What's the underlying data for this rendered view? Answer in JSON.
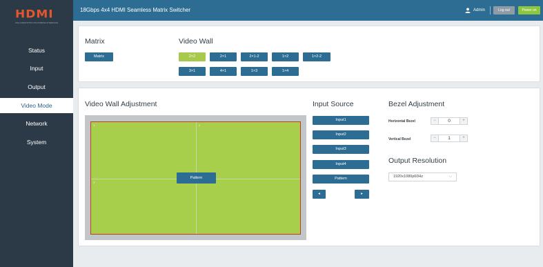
{
  "app": {
    "logo_text": "HDMI",
    "logo_tagline": "HIGH-DEFINITION MULTIMEDIA INTERFACE",
    "title": "18Gbps 4x4 HDMI Seamless Matrix Switcher"
  },
  "header": {
    "user": "Admin",
    "logout_label": "Log out",
    "power_label": "Power on"
  },
  "sidebar": {
    "items": [
      {
        "label": "Status"
      },
      {
        "label": "Input"
      },
      {
        "label": "Output"
      },
      {
        "label": "Video Mode"
      },
      {
        "label": "Network"
      },
      {
        "label": "System"
      }
    ],
    "active": "Video Mode"
  },
  "mode_panel": {
    "matrix_title": "Matrix",
    "matrix_button": "Matrix",
    "videowall_title": "Video Wall",
    "layouts": [
      "2×2",
      "2×1",
      "2×1-2",
      "1×2",
      "1×2-2",
      "3×1",
      "4×1",
      "1×3",
      "1×4"
    ],
    "selected_layout": "2×2"
  },
  "adjust_panel": {
    "title": "Video Wall Adjustment",
    "tile_numbers": [
      "1",
      "2",
      "3"
    ],
    "pattern_label": "Pattern"
  },
  "input_source": {
    "title": "Input Source",
    "buttons": [
      "Input1",
      "Input2",
      "Input3",
      "Input4",
      "Pattern"
    ],
    "prev": "◂",
    "next": "▸"
  },
  "bezel": {
    "title": "Bezel Adjustment",
    "horizontal_label": "Horizontal Bezel",
    "horizontal_value": "0",
    "vertical_label": "Vertical Bezel",
    "vertical_value": "1",
    "minus": "−",
    "plus": "+"
  },
  "output_resolution": {
    "title": "Output Resolution",
    "value": "1920x1080p60Hz",
    "chevron": "⌵"
  },
  "colors": {
    "sidebar": "#2b3a46",
    "topbar": "#2d6d94",
    "accent_green": "#a7c94d",
    "wall_border": "#c0392b"
  }
}
